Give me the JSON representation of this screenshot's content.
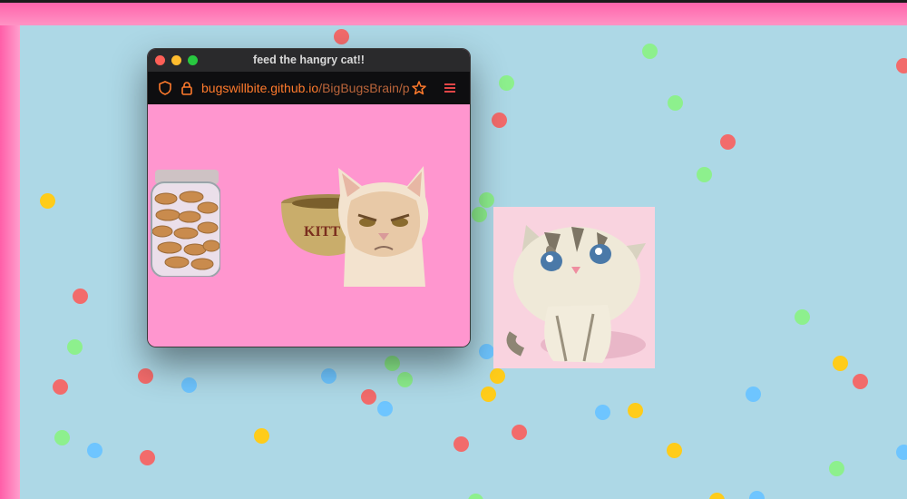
{
  "window": {
    "title": "feed the hangry cat!!",
    "url_host": "bugswillbite.github.io",
    "url_path": "/BigBugsBrain/popup"
  },
  "icons": [
    "shield-icon",
    "lock-icon",
    "star-icon",
    "menu-icon",
    "cookie-jar-image",
    "cat-bowl-image",
    "grumpy-cat-image",
    "kitten-image"
  ],
  "bowl_text": "KITT",
  "colors": {
    "background": "#add8e6",
    "frame": "#ff78b4",
    "popup_bg": "#ff96cf",
    "url_host": "#ff7a2c",
    "confetti": [
      "#f26b6b",
      "#8df08d",
      "#6ec5ff",
      "#ffcc1a"
    ]
  }
}
